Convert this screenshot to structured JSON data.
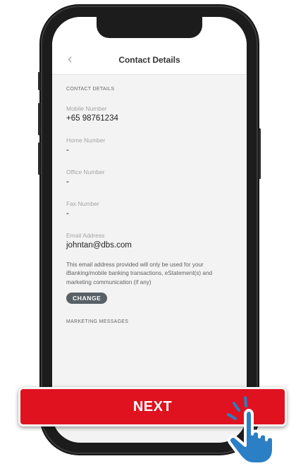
{
  "header": {
    "title": "Contact Details",
    "back_icon": "chevron-left-icon"
  },
  "contact_section": {
    "title": "CONTACT DETAILS"
  },
  "fields": [
    {
      "label": "Mobile Number",
      "value": "+65 98761234"
    },
    {
      "label": "Home Number",
      "value": "-"
    },
    {
      "label": "Office Number",
      "value": "-"
    },
    {
      "label": "Fax Number",
      "value": "-"
    },
    {
      "label": "Email Address",
      "value": "johntan@dbs.com"
    }
  ],
  "email_note": "This email address provided will only be used for your iBanking/mobile banking transactions, eStatement(s) and marketing communication (if any)",
  "change_label": "CHANGE",
  "marketing_section": {
    "title": "MARKETING MESSAGES"
  },
  "next_label": "NEXT",
  "colors": {
    "accent_red": "#e0121f",
    "change_button": "#596166",
    "hand": "#2b7fc4"
  },
  "overlay": {
    "pointer_icon": "hand-pointer-icon"
  }
}
